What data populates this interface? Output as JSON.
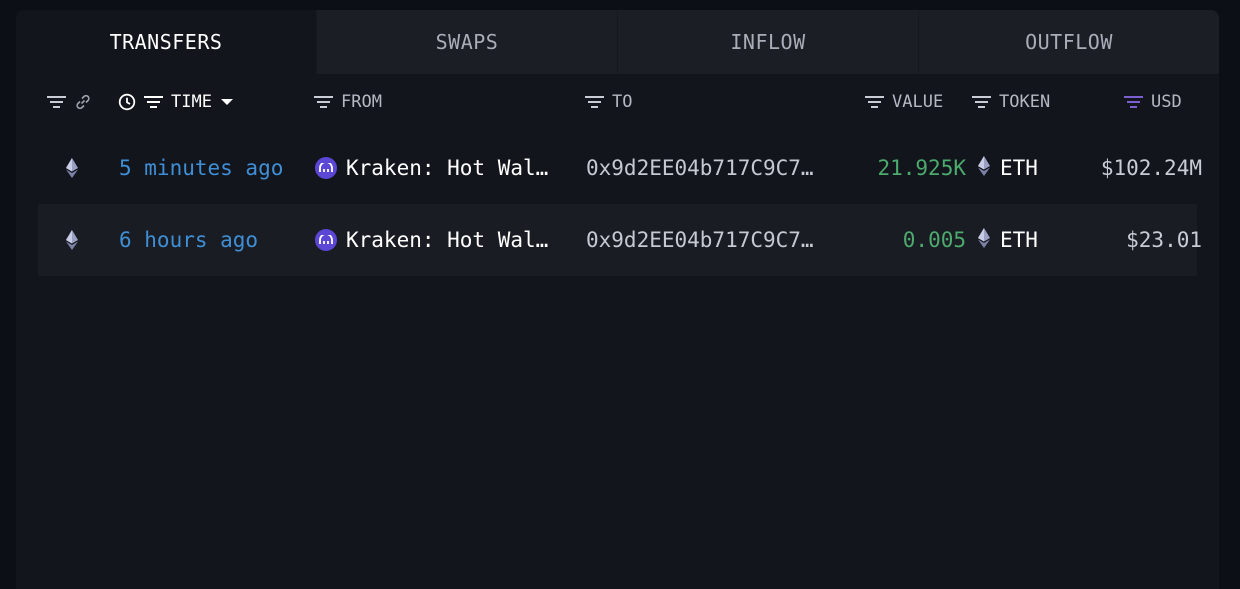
{
  "tabs": [
    {
      "label": "TRANSFERS",
      "active": true
    },
    {
      "label": "SWAPS",
      "active": false
    },
    {
      "label": "INFLOW",
      "active": false
    },
    {
      "label": "OUTFLOW",
      "active": false
    }
  ],
  "columns": {
    "time": "TIME",
    "from": "FROM",
    "to": "TO",
    "value": "VALUE",
    "token": "TOKEN",
    "usd": "USD"
  },
  "rows": [
    {
      "chain_icon": "ethereum-icon",
      "time": "5 minutes ago",
      "from": "Kraken: Hot Wal…",
      "to": "0x9d2EE04b717C9C7…",
      "value": "21.925K",
      "token": "ETH",
      "usd": "$102.24M"
    },
    {
      "chain_icon": "ethereum-icon",
      "time": "6 hours ago",
      "from": "Kraken: Hot Wal…",
      "to": "0x9d2EE04b717C9C7…",
      "value": "0.005",
      "token": "ETH",
      "usd": "$23.01"
    }
  ],
  "colors": {
    "time_link": "#3f8fd6",
    "value_positive": "#4caa6d",
    "usd_filter_active": "#7c5fd1",
    "kraken_brand": "#5b47d6"
  }
}
